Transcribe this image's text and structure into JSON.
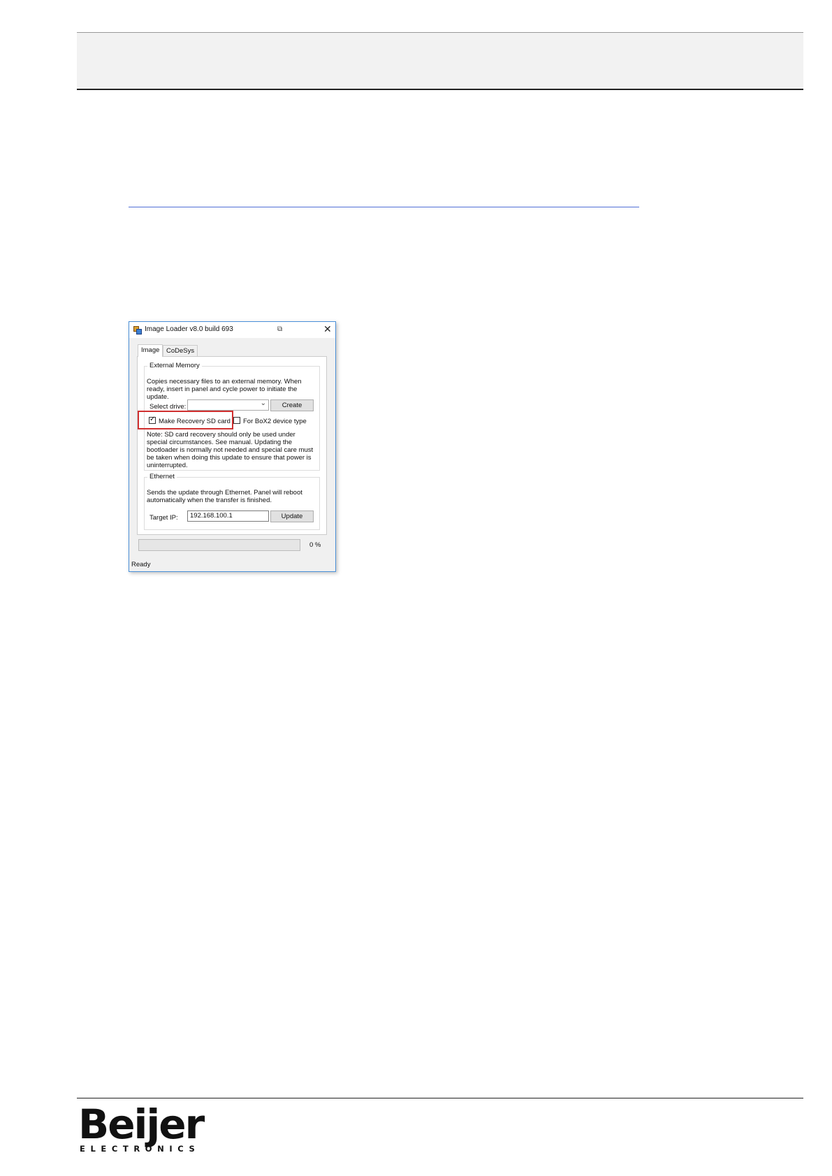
{
  "dialog": {
    "title": "Image Loader v8.0 build 693",
    "tabs": [
      "Image",
      "CoDeSys"
    ],
    "external_memory": {
      "group_label": "External Memory",
      "description": "Copies necessary files to an external memory. When ready, insert in panel and cycle power to initiate the update.",
      "select_drive_label": "Select drive:",
      "select_drive_value": "",
      "create_label": "Create",
      "recovery_label": "Make Recovery SD card",
      "recovery_checked": true,
      "box2_label": "For BoX2 device type",
      "box2_checked": false,
      "note": "Note: SD card recovery should only be used under special circumstances. See manual. Updating the bootloader is normally not needed and special care must be taken when doing this update to ensure that power is uninterrupted."
    },
    "ethernet": {
      "group_label": "Ethernet",
      "description": "Sends the update through Ethernet. Panel will reboot automatically when the transfer is finished.",
      "target_ip_label": "Target IP:",
      "target_ip_value": "192.168.100.1",
      "update_label": "Update"
    },
    "progress_fraction": 0,
    "progress_text": "0 %",
    "status": "Ready"
  },
  "footer": {
    "logo_text": "Beijer",
    "logo_subtext": "ELECTRONICS"
  }
}
